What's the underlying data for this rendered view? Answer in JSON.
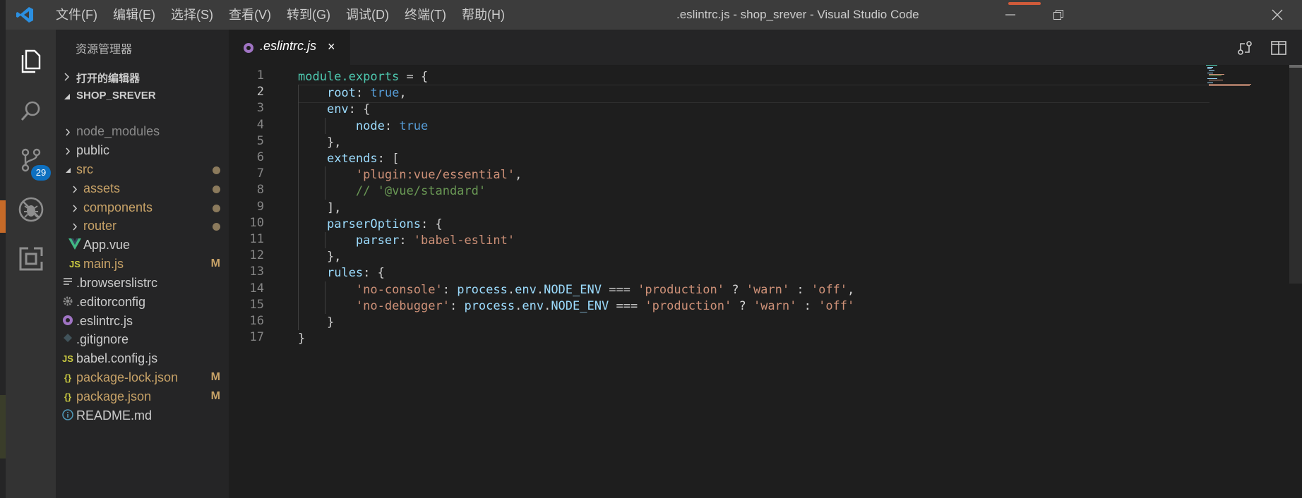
{
  "window": {
    "title": ".eslintrc.js - shop_srever - Visual Studio Code"
  },
  "menu": [
    "文件(F)",
    "编辑(E)",
    "选择(S)",
    "查看(V)",
    "转到(G)",
    "调试(D)",
    "终端(T)",
    "帮助(H)"
  ],
  "activity": {
    "scm_badge": "29"
  },
  "explorer": {
    "title": "资源管理器",
    "open_editors": "打开的编辑器",
    "project": "SHOP_SREVER",
    "items": [
      {
        "name": "node_modules",
        "kind": "folder",
        "color": "#8a8a8a"
      },
      {
        "name": "public",
        "kind": "folder",
        "color": "#cccccc"
      },
      {
        "name": "src",
        "kind": "folder-open",
        "color": "#c7a267",
        "status": "dot"
      },
      {
        "name": "assets",
        "kind": "folder",
        "color": "#c7a267",
        "status": "dot"
      },
      {
        "name": "components",
        "kind": "folder",
        "color": "#c7a267",
        "status": "dot"
      },
      {
        "name": "router",
        "kind": "folder",
        "color": "#c7a267",
        "status": "dot"
      },
      {
        "name": "App.vue",
        "kind": "vue",
        "color": "#cccccc"
      },
      {
        "name": "main.js",
        "kind": "js",
        "color": "#c7a267",
        "status": "M"
      },
      {
        "name": ".browserslistrc",
        "kind": "lines",
        "color": "#cccccc"
      },
      {
        "name": ".editorconfig",
        "kind": "gear",
        "color": "#cccccc"
      },
      {
        "name": ".eslintrc.js",
        "kind": "eslint",
        "color": "#cccccc"
      },
      {
        "name": ".gitignore",
        "kind": "git",
        "color": "#cccccc"
      },
      {
        "name": "babel.config.js",
        "kind": "js",
        "color": "#cccccc"
      },
      {
        "name": "package-lock.json",
        "kind": "json",
        "color": "#c7a267",
        "status": "M"
      },
      {
        "name": "package.json",
        "kind": "json",
        "color": "#c7a267",
        "status": "M"
      },
      {
        "name": "README.md",
        "kind": "info",
        "color": "#cccccc"
      }
    ]
  },
  "tab": {
    "name": ".eslintrc.js",
    "close": "×"
  },
  "editor": {
    "line_numbers": [
      "1",
      "2",
      "3",
      "4",
      "5",
      "6",
      "7",
      "8",
      "9",
      "10",
      "11",
      "12",
      "13",
      "14",
      "15",
      "16",
      "17"
    ],
    "active_line": "2",
    "code": [
      [
        {
          "t": "module.exports",
          "c": "k-mod"
        },
        {
          "t": " = {"
        }
      ],
      [
        {
          "t": "    "
        },
        {
          "t": "root",
          "c": "k-prop"
        },
        {
          "t": ": "
        },
        {
          "t": "true",
          "c": "k-bool"
        },
        {
          "t": ","
        }
      ],
      [
        {
          "t": "    "
        },
        {
          "t": "env",
          "c": "k-prop"
        },
        {
          "t": ": {"
        }
      ],
      [
        {
          "t": "        "
        },
        {
          "t": "node",
          "c": "k-prop"
        },
        {
          "t": ": "
        },
        {
          "t": "true",
          "c": "k-bool"
        }
      ],
      [
        {
          "t": "    },"
        }
      ],
      [
        {
          "t": "    "
        },
        {
          "t": "extends",
          "c": "k-prop"
        },
        {
          "t": ": ["
        }
      ],
      [
        {
          "t": "        "
        },
        {
          "t": "'plugin:vue/essential'",
          "c": "k-str"
        },
        {
          "t": ","
        }
      ],
      [
        {
          "t": "        "
        },
        {
          "t": "// '@vue/standard'",
          "c": "k-com"
        }
      ],
      [
        {
          "t": "    ],"
        }
      ],
      [
        {
          "t": "    "
        },
        {
          "t": "parserOptions",
          "c": "k-prop"
        },
        {
          "t": ": {"
        }
      ],
      [
        {
          "t": "        "
        },
        {
          "t": "parser",
          "c": "k-prop"
        },
        {
          "t": ": "
        },
        {
          "t": "'babel-eslint'",
          "c": "k-str"
        }
      ],
      [
        {
          "t": "    },"
        }
      ],
      [
        {
          "t": "    "
        },
        {
          "t": "rules",
          "c": "k-prop"
        },
        {
          "t": ": {"
        }
      ],
      [
        {
          "t": "        "
        },
        {
          "t": "'no-console'",
          "c": "k-str"
        },
        {
          "t": ": "
        },
        {
          "t": "process",
          "c": "k-prop"
        },
        {
          "t": "."
        },
        {
          "t": "env",
          "c": "k-prop"
        },
        {
          "t": "."
        },
        {
          "t": "NODE_ENV",
          "c": "k-prop"
        },
        {
          "t": " === "
        },
        {
          "t": "'production'",
          "c": "k-str"
        },
        {
          "t": " ? "
        },
        {
          "t": "'warn'",
          "c": "k-str"
        },
        {
          "t": " : "
        },
        {
          "t": "'off'",
          "c": "k-str"
        },
        {
          "t": ","
        }
      ],
      [
        {
          "t": "        "
        },
        {
          "t": "'no-debugger'",
          "c": "k-str"
        },
        {
          "t": ": "
        },
        {
          "t": "process",
          "c": "k-prop"
        },
        {
          "t": "."
        },
        {
          "t": "env",
          "c": "k-prop"
        },
        {
          "t": "."
        },
        {
          "t": "NODE_ENV",
          "c": "k-prop"
        },
        {
          "t": " === "
        },
        {
          "t": "'production'",
          "c": "k-str"
        },
        {
          "t": " ? "
        },
        {
          "t": "'warn'",
          "c": "k-str"
        },
        {
          "t": " : "
        },
        {
          "t": "'off'",
          "c": "k-str"
        }
      ],
      [
        {
          "t": "    }"
        }
      ],
      [
        {
          "t": "}"
        }
      ]
    ]
  },
  "colors": {
    "accent": "#0e70c0",
    "modified": "#c7a267",
    "eslint": "#a074c4"
  }
}
